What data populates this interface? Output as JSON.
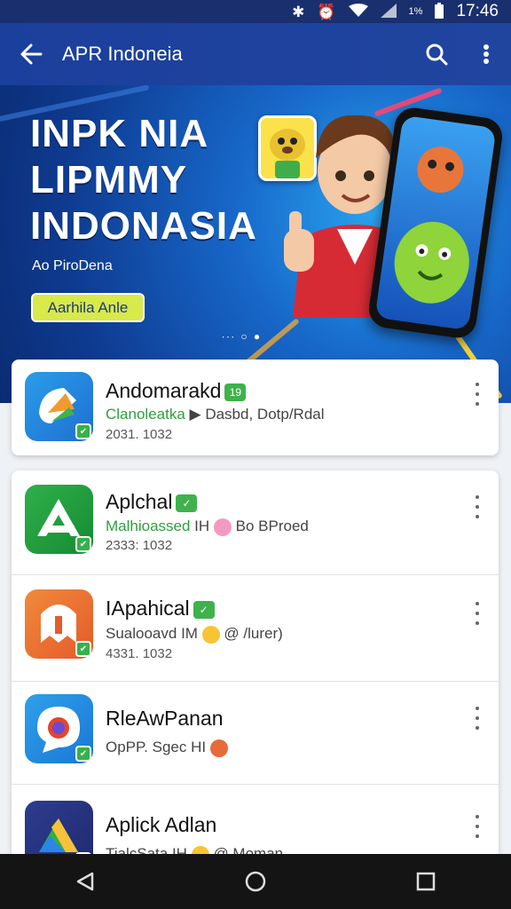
{
  "status_bar": {
    "time": "17:46",
    "battery_label": "1%",
    "icons": [
      "bluetooth-icon",
      "alarm-icon",
      "wifi-icon",
      "signal-icon",
      "battery-icon"
    ]
  },
  "app_bar": {
    "title": "APR Indoneia",
    "icons": [
      "back-arrow-icon",
      "search-icon",
      "more-vert-icon"
    ]
  },
  "banner": {
    "lines": [
      "INPK NIA",
      "LIPMMY",
      "INDONASIA"
    ],
    "subtitle": "Ao PiroDena",
    "cta_label": "Aarhila Anle",
    "dots": "∙∙∙ ○ ●"
  },
  "apps": [
    {
      "name": "Andomarakd",
      "tag": "19",
      "desc_green": "Clanoleatka",
      "desc_rest": "Dasbd, Dotp/Rdal",
      "meta": "2031. 1032",
      "icon_colors": [
        "#2a9de8",
        "#1e6fd1"
      ]
    },
    {
      "name": "Aplchal",
      "tag": "✓",
      "desc_green": "Malhioassed",
      "desc_rest": "Bo BProed",
      "meta": "2333: 1032",
      "icon_colors": [
        "#2fb04a",
        "#168a33"
      ]
    },
    {
      "name": "IApahical",
      "tag": "✓",
      "desc_green": "",
      "desc_rest": "Sualooavd IM",
      "desc_tail": "@ /lurer)",
      "meta": "4331. 1032",
      "icon_colors": [
        "#f08a3a",
        "#e55a2b"
      ]
    },
    {
      "name": "RleAwPanan",
      "tag": "",
      "desc_green": "",
      "desc_rest": "OpPP. Sgec HI",
      "meta": "",
      "icon_colors": [
        "#2fa0ea",
        "#1a77d6"
      ]
    },
    {
      "name": "Aplick Adlan",
      "tag": "",
      "desc_green": "",
      "desc_rest": "TialcSata IH",
      "desc_tail": "@ Moman",
      "meta": "",
      "icon_colors": [
        "#2d3c8f",
        "#1f2a6e"
      ]
    }
  ]
}
